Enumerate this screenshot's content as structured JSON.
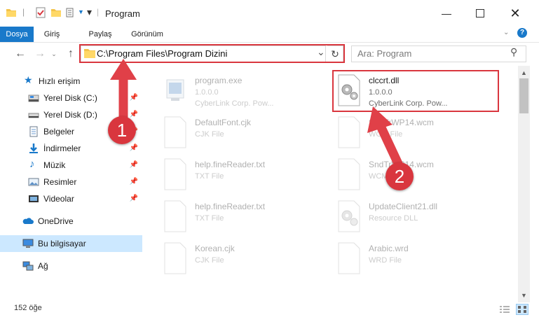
{
  "window": {
    "title": "Program",
    "minimize_icon": "minimize-icon",
    "maximize_icon": "maximize-icon",
    "close_icon": "close-icon"
  },
  "ribbon": {
    "tabs": [
      {
        "label": "Dosya"
      },
      {
        "label": "Giriş"
      },
      {
        "label": "Paylaş"
      },
      {
        "label": "Görünüm"
      }
    ]
  },
  "address": {
    "path": "C:\\Program Files\\Program Dizini"
  },
  "search": {
    "placeholder": "Ara: Program"
  },
  "sidebar": {
    "items": [
      {
        "label": "Hızlı erişim",
        "icon": "star-icon"
      },
      {
        "label": "Yerel Disk (C:)",
        "icon": "drive-icon"
      },
      {
        "label": "Yerel Disk (D:)",
        "icon": "drive-icon"
      },
      {
        "label": "Belgeler",
        "icon": "documents-icon"
      },
      {
        "label": "İndirmeler",
        "icon": "download-icon"
      },
      {
        "label": "Müzik",
        "icon": "music-icon"
      },
      {
        "label": "Resimler",
        "icon": "pictures-icon"
      },
      {
        "label": "Videolar",
        "icon": "video-icon"
      },
      {
        "label": "OneDrive",
        "icon": "cloud-icon"
      },
      {
        "label": "Bu bilgisayar",
        "icon": "computer-icon"
      },
      {
        "label": "Ağ",
        "icon": "network-icon"
      }
    ]
  },
  "files": [
    {
      "name": "program.exe",
      "sub1": "1.0.0.0",
      "sub2": "CyberLink Corp. Pow...",
      "icon": "exe-icon"
    },
    {
      "name": "clccrt.dll",
      "sub1": "1.0.0.0",
      "sub2": "CyberLink Corp. Pow...",
      "icon": "dll-gear-icon"
    },
    {
      "name": "DefaultFont.cjk",
      "sub1": "CJK File",
      "sub2": "",
      "icon": "document-icon"
    },
    {
      "name": "SndTrWP14.wcm",
      "sub1": "WCM File",
      "sub2": "",
      "icon": "document-icon"
    },
    {
      "name": "help.fineReader.txt",
      "sub1": "TXT File",
      "sub2": "",
      "icon": "document-icon"
    },
    {
      "name": "SndTrWP14.wcm",
      "sub1": "WCM File",
      "sub2": "",
      "icon": "document-icon"
    },
    {
      "name": "help.fineReader.txt",
      "sub1": "TXT File",
      "sub2": "",
      "icon": "document-icon"
    },
    {
      "name": "UpdateClient21.dll",
      "sub1": "Resource DLL",
      "sub2": "",
      "icon": "dll-gear-icon"
    },
    {
      "name": "Korean.cjk",
      "sub1": "CJK File",
      "sub2": "",
      "icon": "document-icon"
    },
    {
      "name": "Arabic.wrd",
      "sub1": "WRD File",
      "sub2": "",
      "icon": "document-icon"
    }
  ],
  "status": {
    "count": "152 öğe"
  },
  "callouts": [
    {
      "number": "1"
    },
    {
      "number": "2"
    }
  ],
  "colors": {
    "accent": "#1979ca",
    "highlight_red": "#d9363e",
    "selected_nav": "#cce8ff"
  }
}
